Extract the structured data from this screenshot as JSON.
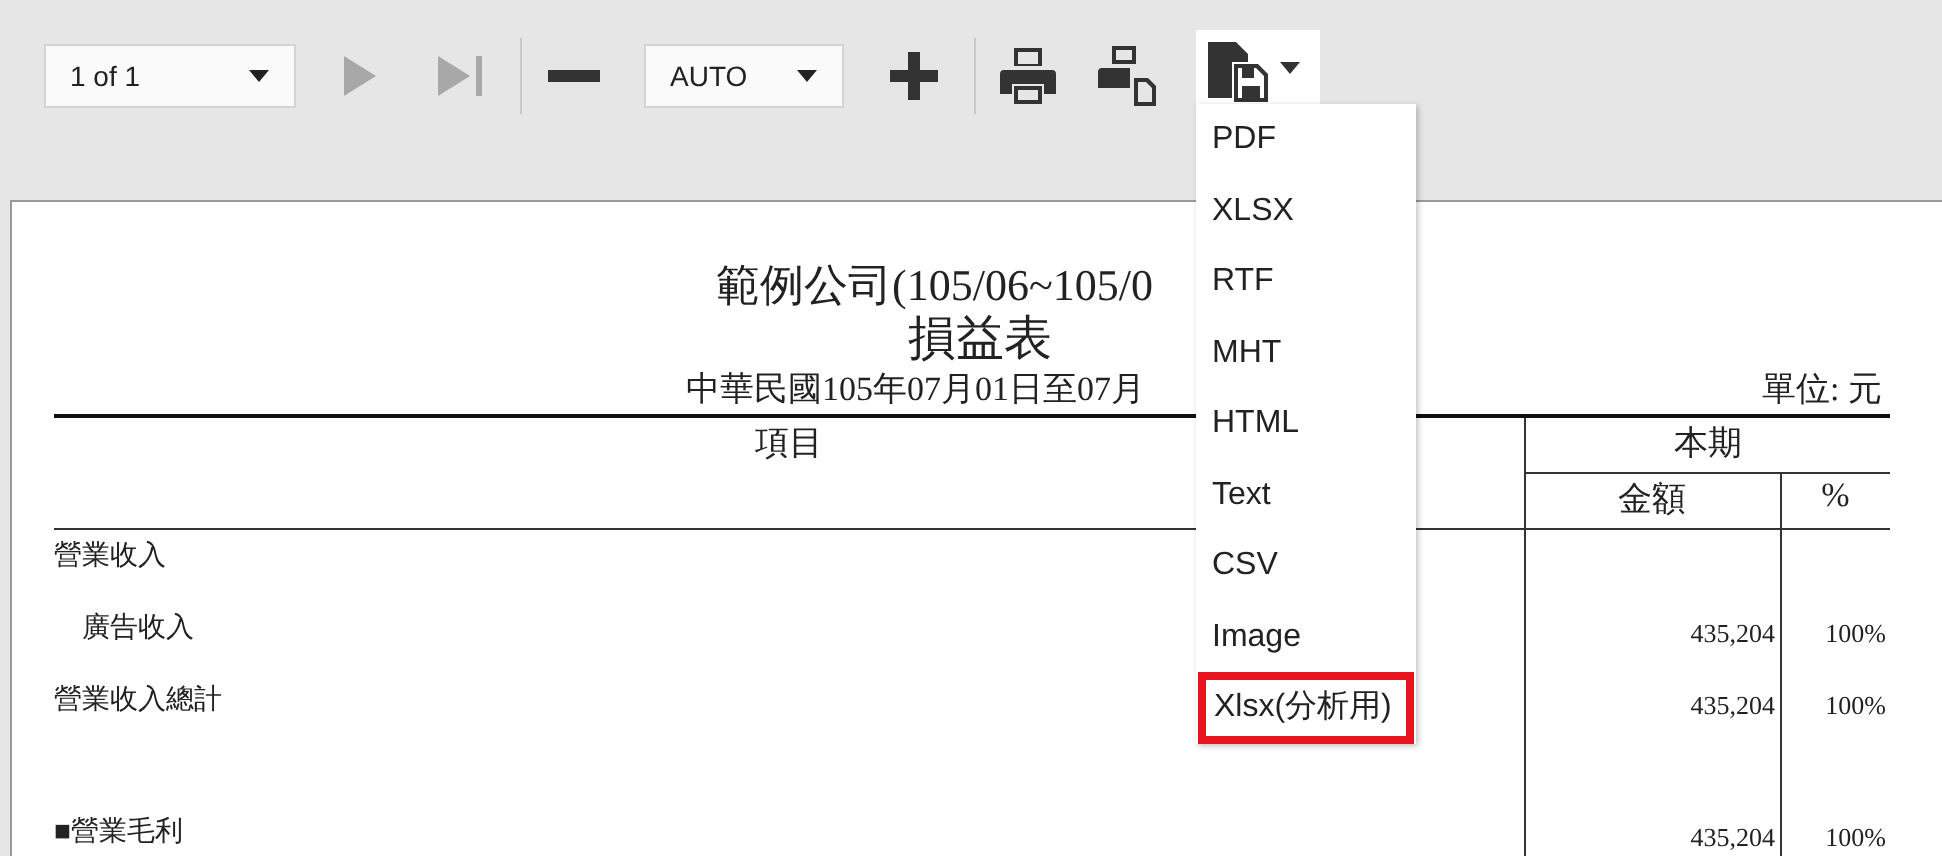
{
  "toolbar": {
    "page_select": {
      "value": "1 of 1"
    },
    "nav_buttons": [
      {
        "kind": "next",
        "disabled": true
      },
      {
        "kind": "last",
        "disabled": true
      }
    ],
    "zoom_buttons": [
      {
        "kind": "zoom-out",
        "disabled": false
      }
    ],
    "zoom_select": {
      "value": "AUTO"
    },
    "zoom_in": {
      "kind": "zoom-in",
      "disabled": false
    },
    "tool_buttons": [
      {
        "kind": "print",
        "disabled": false
      },
      {
        "kind": "print-layout",
        "disabled": false
      }
    ],
    "export": {
      "expanded": true,
      "items": [
        {
          "label": "PDF",
          "highlighted": false
        },
        {
          "label": "XLSX",
          "highlighted": false
        },
        {
          "label": "RTF",
          "highlighted": false
        },
        {
          "label": "MHT",
          "highlighted": false
        },
        {
          "label": "HTML",
          "highlighted": false
        },
        {
          "label": "Text",
          "highlighted": false
        },
        {
          "label": "CSV",
          "highlighted": false
        },
        {
          "label": "Image",
          "highlighted": false
        },
        {
          "label": "Xlsx(分析用)",
          "highlighted": true
        }
      ]
    }
  },
  "report": {
    "title": "範例公司(105/06~105/0",
    "subtitle": "損益表",
    "period": "中華民國105年07月01日至07月",
    "unit": "單位: 元",
    "columns": {
      "item": "項目",
      "period": "本期",
      "amount": "金額",
      "percent": "%"
    },
    "rows": [
      {
        "kind": "line",
        "label": "營業收入",
        "children": [
          {
            "kind": "line",
            "label": "廣告收入",
            "amount": "435,204",
            "percent": "100%"
          }
        ]
      },
      {
        "kind": "line",
        "label": "營業收入總計",
        "amount": "435,204",
        "percent": "100%"
      },
      {
        "kind": "spacer"
      },
      {
        "kind": "line",
        "label": "■營業毛利",
        "amount": "435,204",
        "percent": "100%"
      }
    ]
  }
}
